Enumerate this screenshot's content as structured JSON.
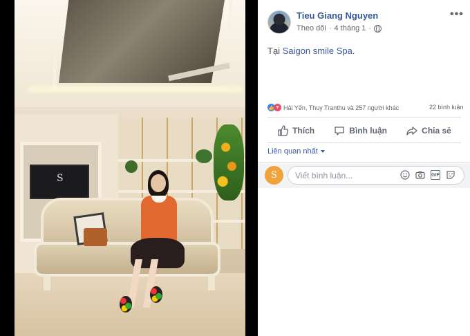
{
  "post": {
    "author": "Tieu Giang Nguyen",
    "follow": "Theo dõi",
    "separator": "·",
    "date": "4 tháng 1",
    "text_prefix": "Tại",
    "place": "Saigon smile Spa",
    "text_suffix": "."
  },
  "reactions": {
    "summary": "Hải Yến, Thuy Tranthu và 257 người khác",
    "comments": "22 bình luận"
  },
  "actions": {
    "like": "Thích",
    "comment": "Bình luận",
    "share": "Chia sẻ"
  },
  "comments": {
    "sort": "Liên quan nhất",
    "placeholder": "Viết bình luận...",
    "avatar_initial": "S"
  },
  "photo": {
    "tv_logo": "S"
  },
  "colors": {
    "link": "#385898",
    "text": "#4b4f56",
    "muted": "#606770"
  },
  "icons": [
    "globe-icon",
    "more-icon",
    "like-icon",
    "love-icon",
    "thumbs-up-icon",
    "comment-icon",
    "share-icon",
    "caret-down-icon",
    "emoji-icon",
    "camera-icon",
    "gif-icon",
    "sticker-icon"
  ]
}
